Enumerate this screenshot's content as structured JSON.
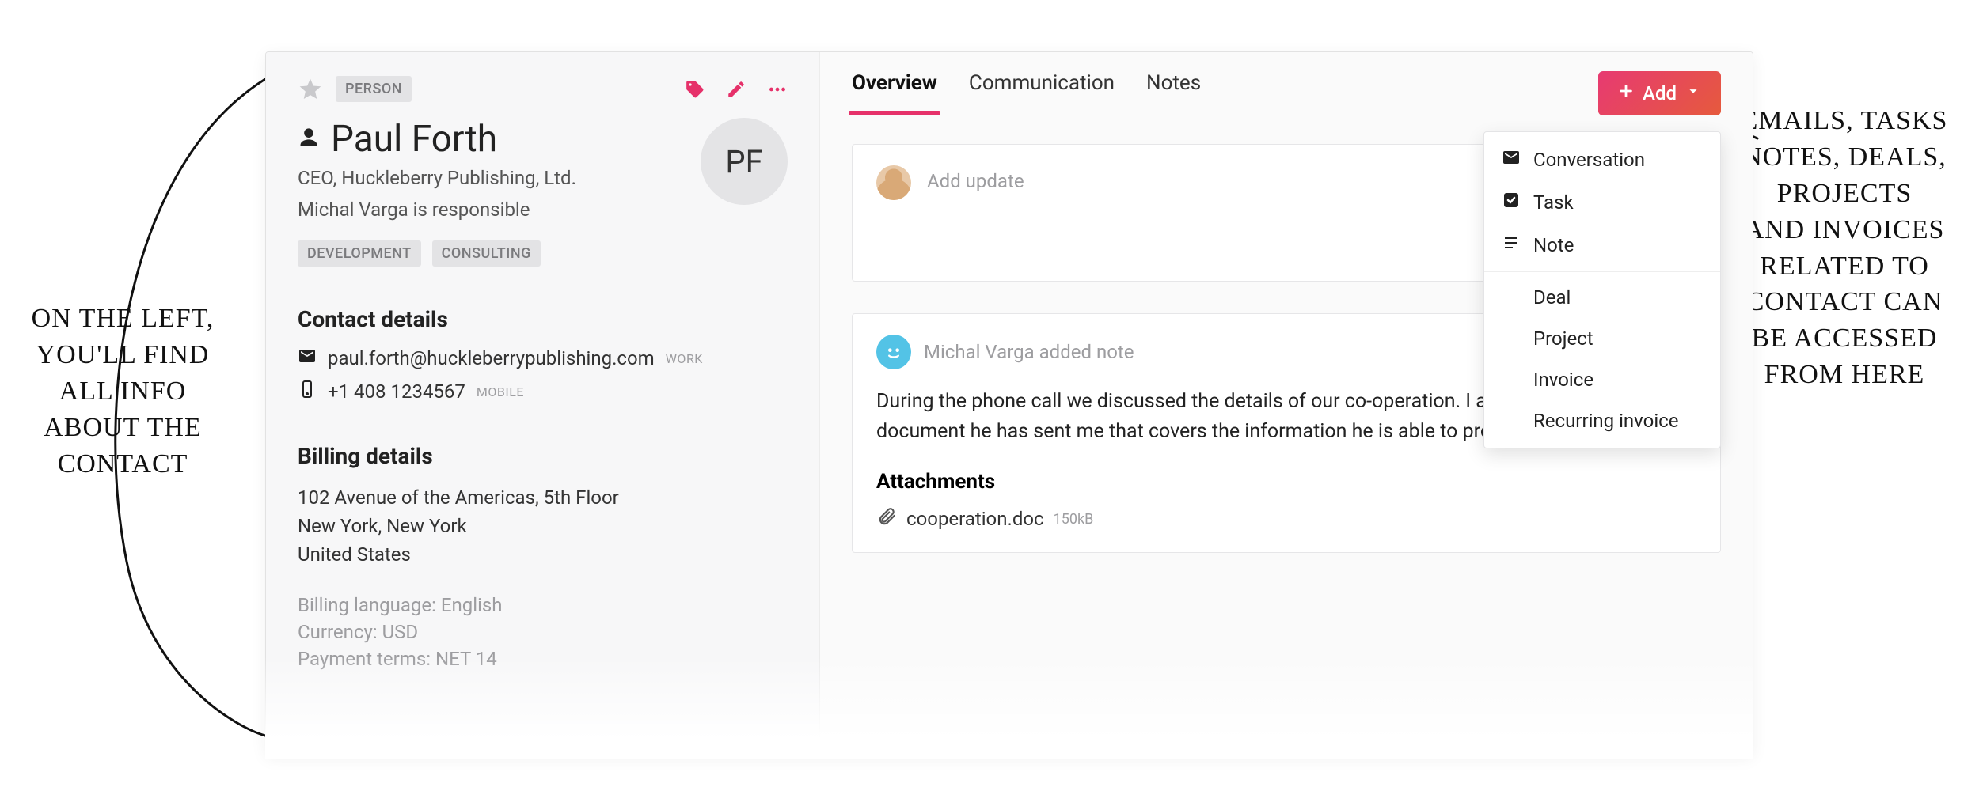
{
  "annotations": {
    "left": "ON THE LEFT,\nYOU'LL FIND\nALL INFO\nABOUT THE\nCONTACT",
    "right": "EMAILS, TASKS\nNOTES, DEALS,\nPROJECTS\nAND INVOICES\nRELATED TO\nCONTACT CAN\nBE ACCESSED\nFROM HERE"
  },
  "contact": {
    "type_badge": "PERSON",
    "name": "Paul Forth",
    "subtitle1": "CEO, Huckleberry Publishing, Ltd.",
    "subtitle2": "Michal Varga is responsible",
    "initials": "PF",
    "tags": [
      "DEVELOPMENT",
      "CONSULTING"
    ]
  },
  "sections": {
    "contact_details_title": "Contact details",
    "email": "paul.forth@huckleberrypublishing.com",
    "email_tag": "WORK",
    "phone": "+1 408 1234567",
    "phone_tag": "MOBILE",
    "billing_details_title": "Billing details",
    "addr1": "102 Avenue of the Americas, 5th Floor",
    "addr2": "New York, New York",
    "addr3": "United States",
    "billing_language_k": "Billing language:",
    "billing_language_v": "English",
    "currency_k": "Currency:",
    "currency_v": "USD",
    "payment_terms_k": "Payment terms:",
    "payment_terms_v": "NET 14"
  },
  "tabs": {
    "overview": "Overview",
    "communication": "Communication",
    "notes": "Notes"
  },
  "add_button": "Add",
  "dropdown": {
    "conversation": "Conversation",
    "task": "Task",
    "note": "Note",
    "deal": "Deal",
    "project": "Project",
    "invoice": "Invoice",
    "recurring_invoice": "Recurring invoice"
  },
  "feed": {
    "update_placeholder": "Add update",
    "note_author_line": "Michal Varga added note",
    "note_body": "During the phone call we discussed the details of our co-operation. I am attaching a document he has sent me that covers the information he is able to provide.",
    "attachments_title": "Attachments",
    "attachment_name": "cooperation.doc",
    "attachment_size": "150kB"
  }
}
